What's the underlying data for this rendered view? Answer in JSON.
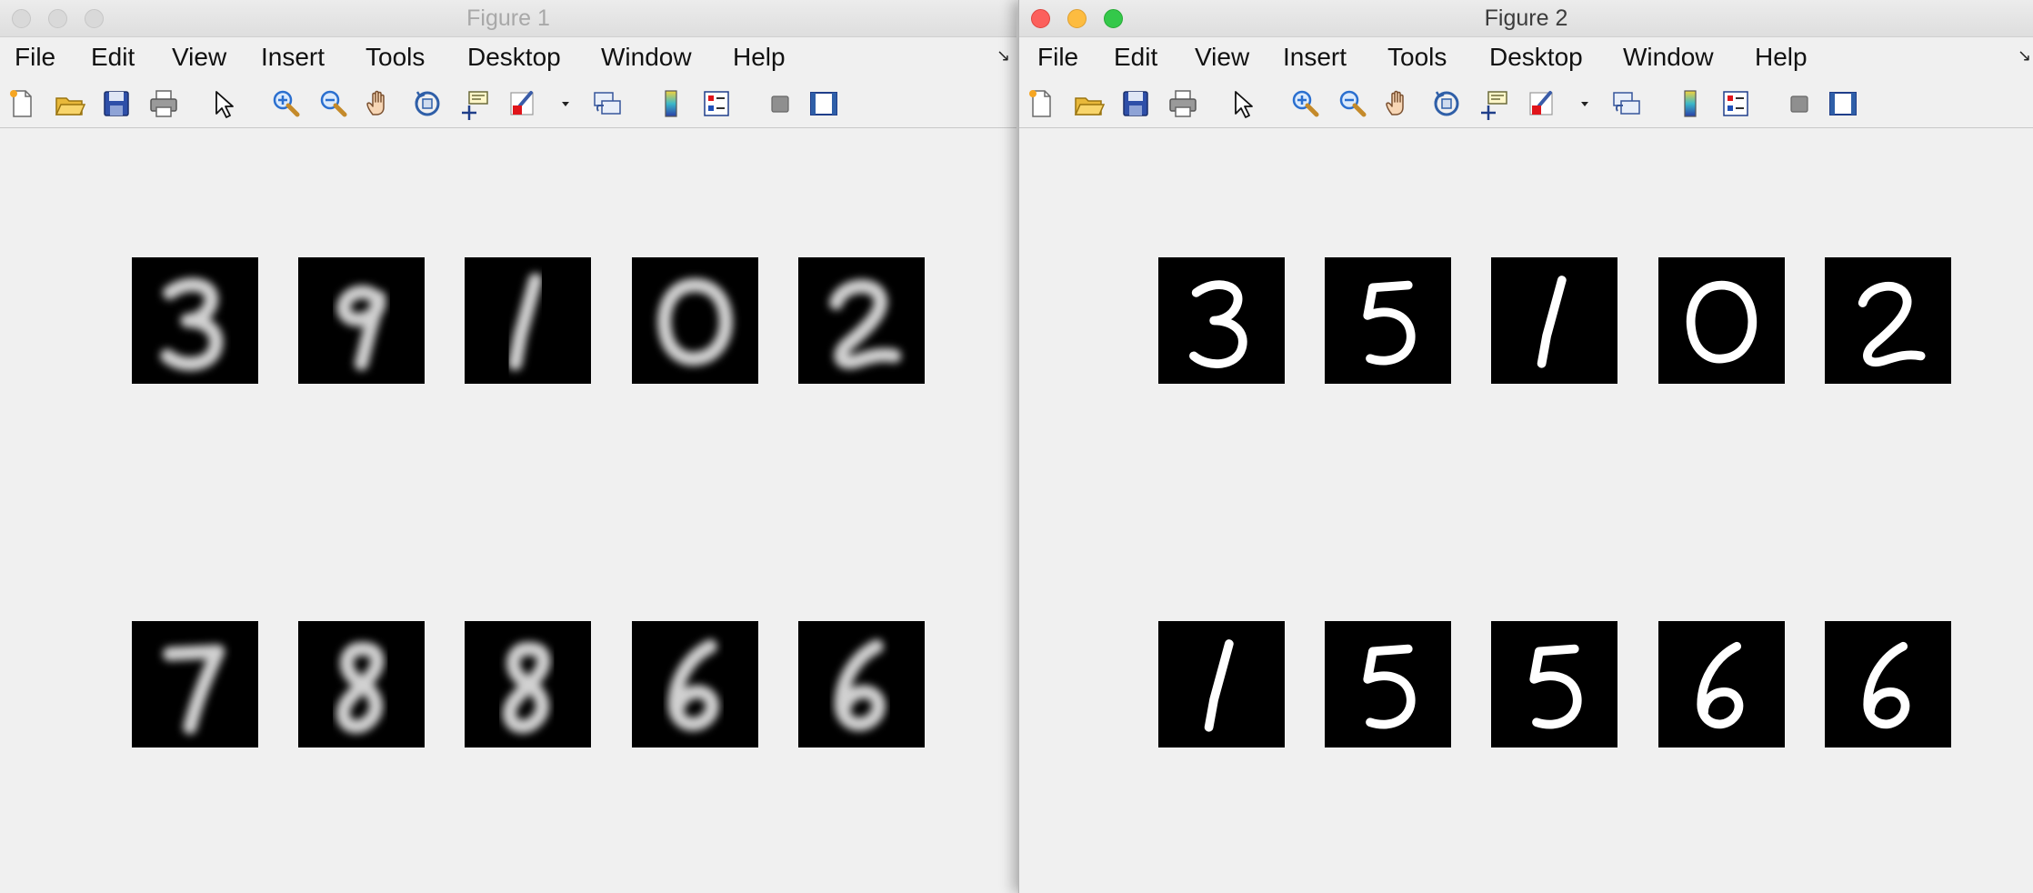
{
  "windows": [
    {
      "title": "Figure 1",
      "active": false,
      "menu": [
        "File",
        "Edit",
        "View",
        "Insert",
        "Tools",
        "Desktop",
        "Window",
        "Help"
      ],
      "dock_glyph": "↘",
      "toolbar_icons": [
        "new-figure-icon",
        "open-file-icon",
        "save-icon",
        "print-icon",
        "edit-plot-arrow-icon",
        "zoom-in-icon",
        "zoom-out-icon",
        "pan-hand-icon",
        "rotate-3d-icon",
        "data-cursor-icon",
        "brush-icon",
        "brush-dropdown-icon",
        "link-plot-icon",
        "colorbar-icon",
        "legend-icon",
        "hide-plot-tools-icon",
        "show-plot-tools-icon"
      ],
      "digits_row1": [
        "3",
        "9",
        "1",
        "0",
        "2"
      ],
      "digits_row2": [
        "7",
        "8",
        "8",
        "6",
        "6"
      ],
      "digit_style": "blurred"
    },
    {
      "title": "Figure 2",
      "active": true,
      "menu": [
        "File",
        "Edit",
        "View",
        "Insert",
        "Tools",
        "Desktop",
        "Window",
        "Help"
      ],
      "dock_glyph": "↘",
      "toolbar_icons": [
        "new-figure-icon",
        "open-file-icon",
        "save-icon",
        "print-icon",
        "edit-plot-arrow-icon",
        "zoom-in-icon",
        "zoom-out-icon",
        "pan-hand-icon",
        "rotate-3d-icon",
        "data-cursor-icon",
        "brush-icon",
        "brush-dropdown-icon",
        "link-plot-icon",
        "colorbar-icon",
        "legend-icon",
        "hide-plot-tools-icon",
        "show-plot-tools-icon"
      ],
      "digits_row1": [
        "3",
        "5",
        "1",
        "0",
        "2"
      ],
      "digits_row2": [
        "1",
        "5",
        "5",
        "6",
        "6"
      ],
      "digit_style": "sharp"
    }
  ],
  "colors": {
    "close": "#fc605c",
    "minimize": "#fdbc40",
    "maximize": "#34c84a",
    "inactive_button": "#d9d9d9",
    "figure_background": "#f0f0f0",
    "image_background": "#000000",
    "digit_stroke": "#ffffff"
  }
}
